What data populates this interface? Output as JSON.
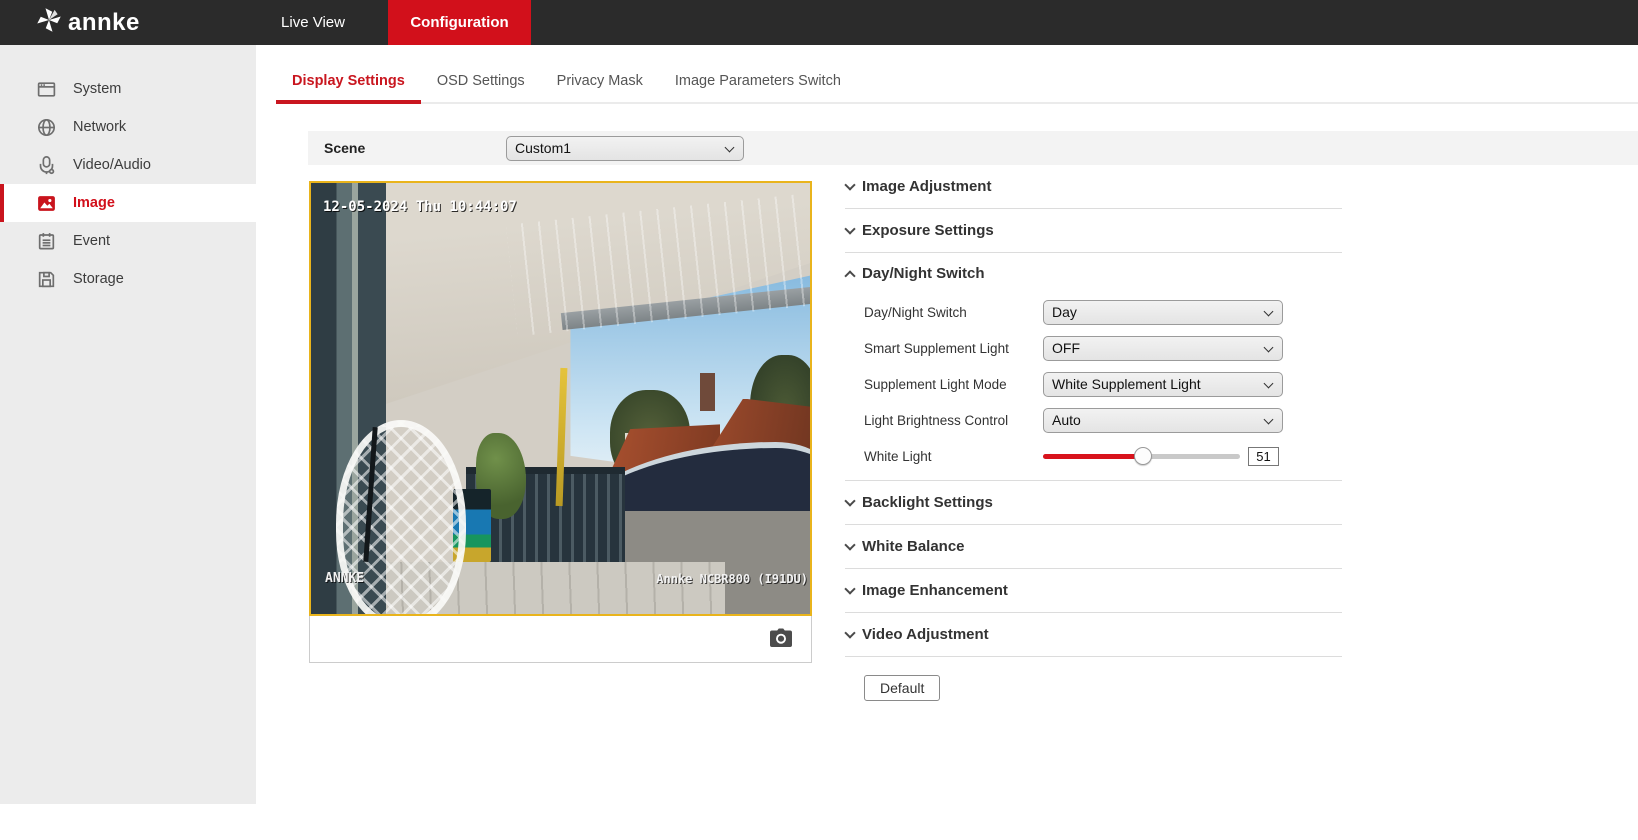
{
  "topbar": {
    "brand": "annke",
    "live_view": "Live View",
    "configuration": "Configuration"
  },
  "sidebar": {
    "items": [
      {
        "label": "System",
        "icon": "system-window-icon",
        "active": false
      },
      {
        "label": "Network",
        "icon": "network-globe-icon",
        "active": false
      },
      {
        "label": "Video/Audio",
        "icon": "microphone-icon",
        "active": false
      },
      {
        "label": "Image",
        "icon": "image-picture-icon",
        "active": true
      },
      {
        "label": "Event",
        "icon": "event-note-icon",
        "active": false
      },
      {
        "label": "Storage",
        "icon": "storage-disk-icon",
        "active": false
      }
    ]
  },
  "tabs": {
    "items": [
      {
        "label": "Display Settings",
        "active": true
      },
      {
        "label": "OSD Settings",
        "active": false
      },
      {
        "label": "Privacy Mask",
        "active": false
      },
      {
        "label": "Image Parameters Switch",
        "active": false
      }
    ]
  },
  "scene": {
    "label": "Scene",
    "value": "Custom1"
  },
  "preview": {
    "timestamp": "12-05-2024 Thu 10:44:07",
    "watermark_left": "ANNKE",
    "watermark_right": "Annke NCBR800 (I91DU)",
    "capture_icon": "camera-capture-icon"
  },
  "sections": {
    "image_adjustment": {
      "title": "Image Adjustment",
      "state": "collapsed"
    },
    "exposure_settings": {
      "title": "Exposure Settings",
      "state": "collapsed"
    },
    "day_night": {
      "title": "Day/Night Switch",
      "state": "expanded",
      "rows": [
        {
          "label": "Day/Night Switch",
          "control": "select",
          "value": "Day"
        },
        {
          "label": "Smart Supplement Light",
          "control": "select",
          "value": "OFF"
        },
        {
          "label": "Supplement Light Mode",
          "control": "select",
          "value": "White Supplement Light"
        },
        {
          "label": "Light Brightness Control",
          "control": "select",
          "value": "Auto"
        },
        {
          "label": "White Light",
          "control": "slider",
          "value": 51,
          "min": 0,
          "max": 100
        }
      ]
    },
    "backlight": {
      "title": "Backlight Settings",
      "state": "collapsed"
    },
    "white_balance": {
      "title": "White Balance",
      "state": "collapsed"
    },
    "image_enhancement": {
      "title": "Image Enhancement",
      "state": "collapsed"
    },
    "video_adjustment": {
      "title": "Video Adjustment",
      "state": "collapsed"
    }
  },
  "buttons": {
    "default_label": "Default"
  },
  "colors": {
    "accent_red": "#d2101b",
    "topbar_bg": "#2b2b2b",
    "sidebar_bg": "#ececec",
    "preview_border": "#e9b41c",
    "slider_fill": "#d8131c"
  }
}
